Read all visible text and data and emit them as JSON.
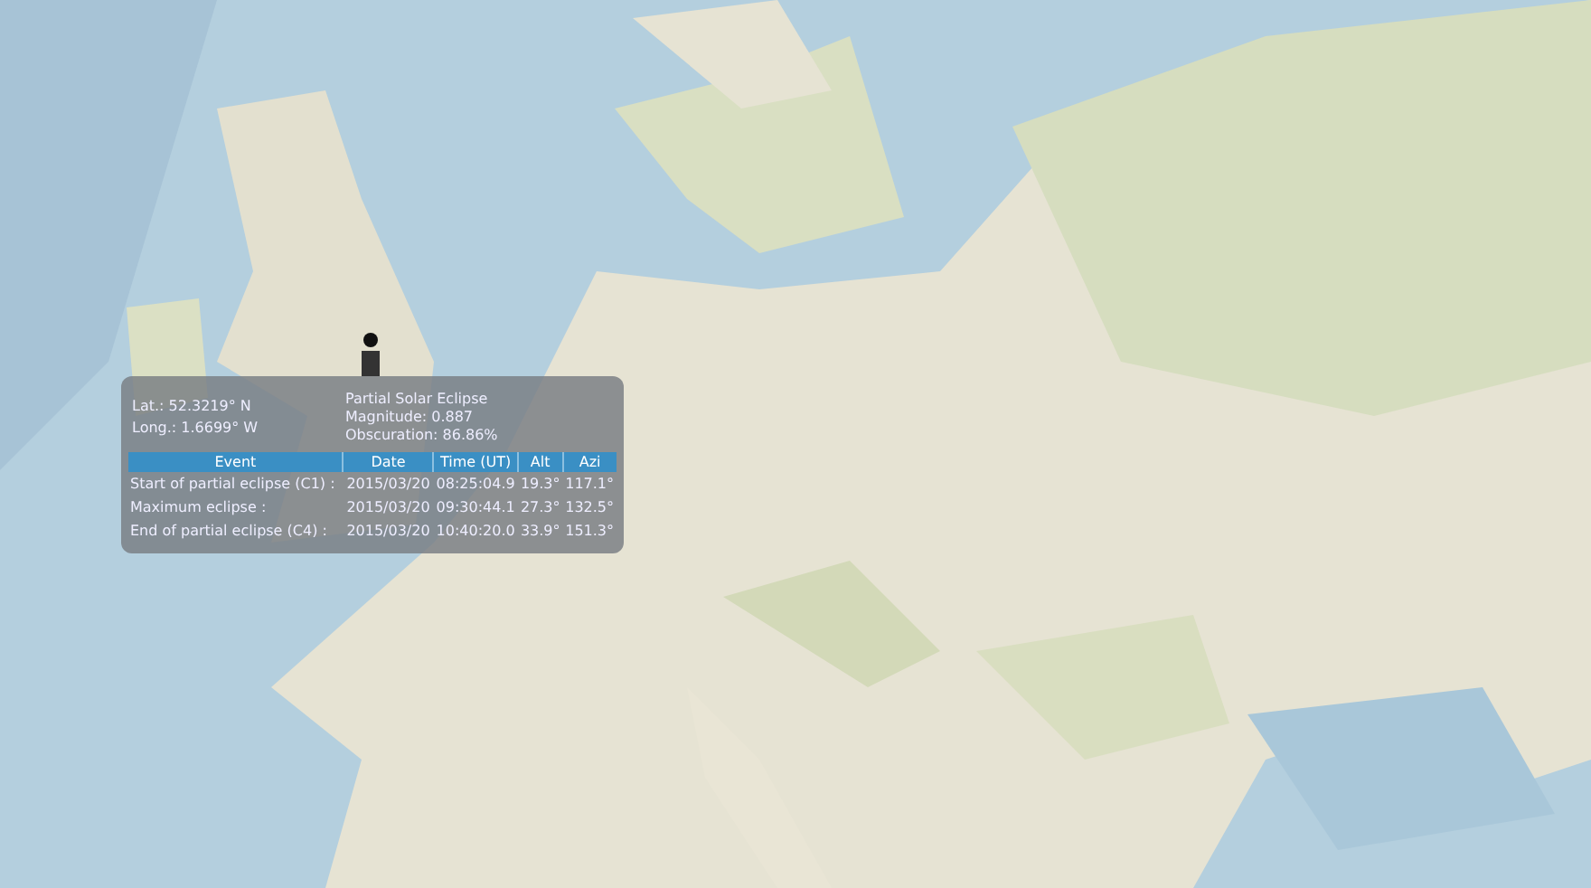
{
  "popup": {
    "lat": "Lat.: 52.3219° N",
    "long": "Long.: 1.6699° W",
    "title": "Partial Solar Eclipse",
    "magnitude": "Magnitude: 0.887",
    "obscuration": "Obscuration: 86.86%",
    "table": {
      "columns": [
        "Event",
        "Date",
        "Time (UT)",
        "Alt",
        "Azi"
      ],
      "rows": [
        [
          "Start of partial eclipse (C1) :",
          "2015/03/20",
          "08:25:04.9",
          "19.3°",
          "117.1°"
        ],
        [
          "Maximum eclipse :",
          "2015/03/20",
          "09:30:44.1",
          "27.3°",
          "132.5°"
        ],
        [
          "End of partial eclipse (C4) :",
          "2015/03/20",
          "10:40:20.0",
          "33.9°",
          "151.3°"
        ]
      ]
    }
  }
}
